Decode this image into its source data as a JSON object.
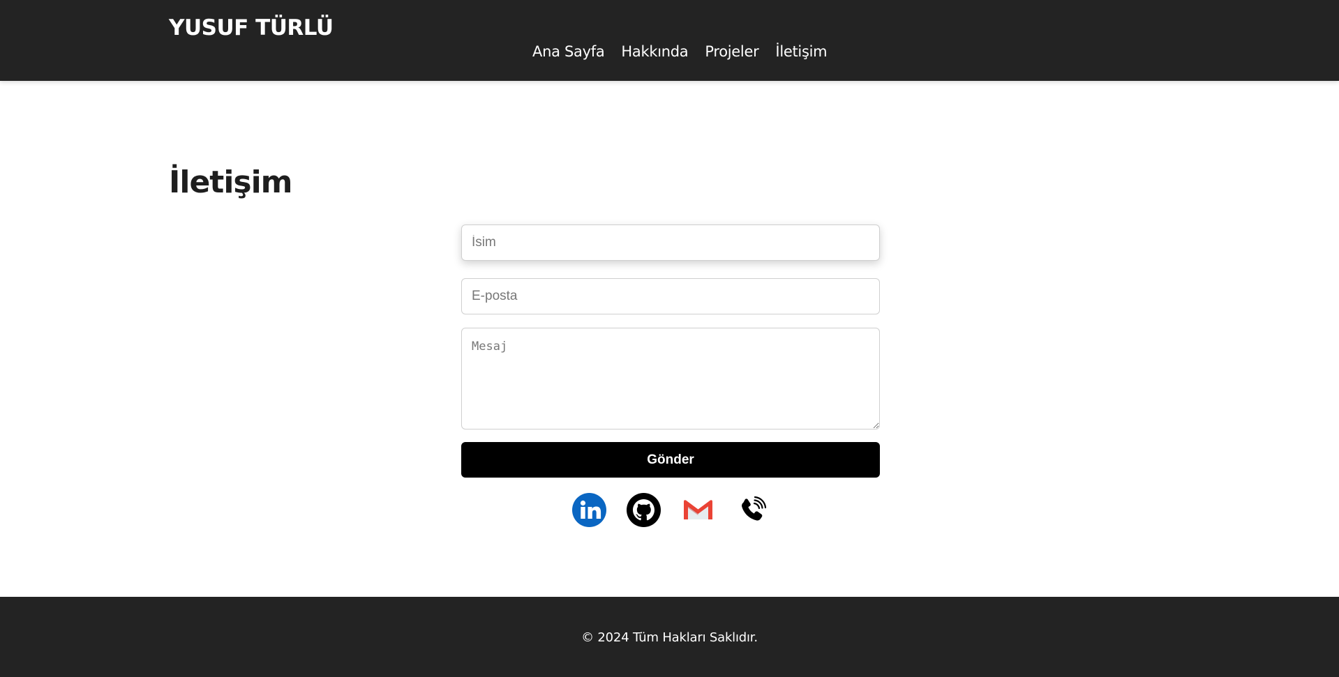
{
  "header": {
    "brand": "YUSUF TÜRLÜ",
    "nav": [
      {
        "label": "Ana Sayfa"
      },
      {
        "label": "Hakkında"
      },
      {
        "label": "Projeler"
      },
      {
        "label": "İletişim"
      }
    ]
  },
  "main": {
    "title": "İletişim",
    "form": {
      "name_placeholder": "İsim",
      "email_placeholder": "E-posta",
      "message_placeholder": "Mesaj",
      "submit_label": "Gönder"
    },
    "socials": [
      {
        "icon": "linkedin-icon",
        "color": "#0a66c2"
      },
      {
        "icon": "github-icon",
        "color": "#000000"
      },
      {
        "icon": "gmail-icon",
        "color": "#ea4335"
      },
      {
        "icon": "phone-icon",
        "color": "#000000"
      }
    ]
  },
  "footer": {
    "copyright": "© 2024 Tüm Hakları Saklıdır."
  },
  "colors": {
    "header_bg": "#232323",
    "footer_bg": "#232323",
    "button_bg": "#000000"
  }
}
